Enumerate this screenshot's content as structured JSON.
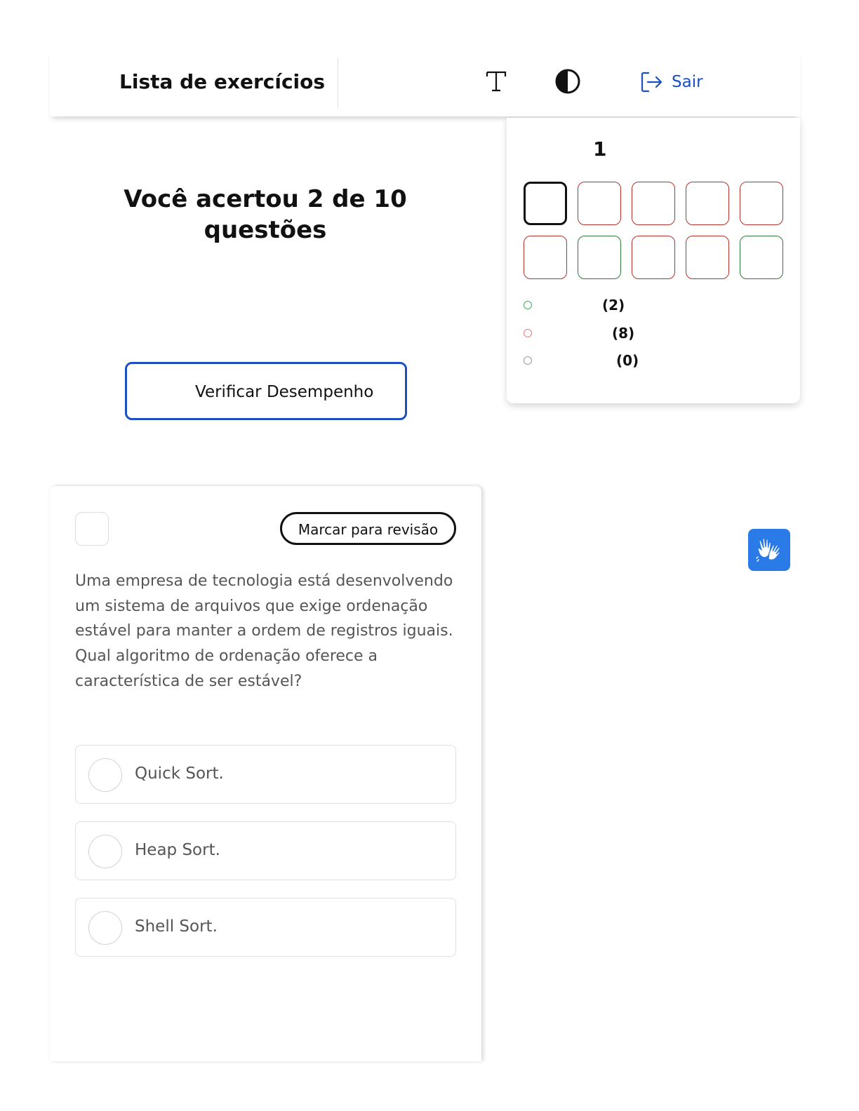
{
  "header": {
    "title": "Lista de exercícios",
    "font_icon": "font-size-icon",
    "contrast_icon": "contrast-icon",
    "exit_icon": "logout-icon",
    "exit_label": "Sair"
  },
  "result": {
    "title": "Você acertou 2 de 10 questões",
    "verify_button_label": "Verificar Desempenho"
  },
  "navigation": {
    "current_question": "1",
    "questions": [
      {
        "status": "current"
      },
      {
        "status": "wrong"
      },
      {
        "status": "wrong"
      },
      {
        "status": "wrong"
      },
      {
        "status": "wrong"
      },
      {
        "status": "wrong"
      },
      {
        "status": "right"
      },
      {
        "status": "wrong"
      },
      {
        "status": "wrong"
      },
      {
        "status": "right"
      }
    ],
    "legend": [
      {
        "count": "(2)",
        "color": "#3cb35a"
      },
      {
        "count": "(8)",
        "color": "#e87c78"
      },
      {
        "count": "(0)",
        "color": "#9a9a9a"
      }
    ]
  },
  "question": {
    "review_button_label": "Marcar para revisão",
    "text_line1": "Uma empresa de tecnologia está desenvolvendo um sistema de arquivos que exige ordenação estável para manter a ordem de registros iguais.",
    "text_line2": "Qual algoritmo de ordenação oferece a característica de ser estável?",
    "options": [
      {
        "label": "Quick Sort."
      },
      {
        "label": "Heap Sort."
      },
      {
        "label": "Shell Sort."
      }
    ]
  },
  "accessibility": {
    "libras_icon": "sign-language-hands-icon"
  },
  "colors": {
    "accent": "#1a4fc4",
    "wrong": "#b5312b",
    "right": "#2e7a3c",
    "libras_bg": "#2a7ae8"
  }
}
